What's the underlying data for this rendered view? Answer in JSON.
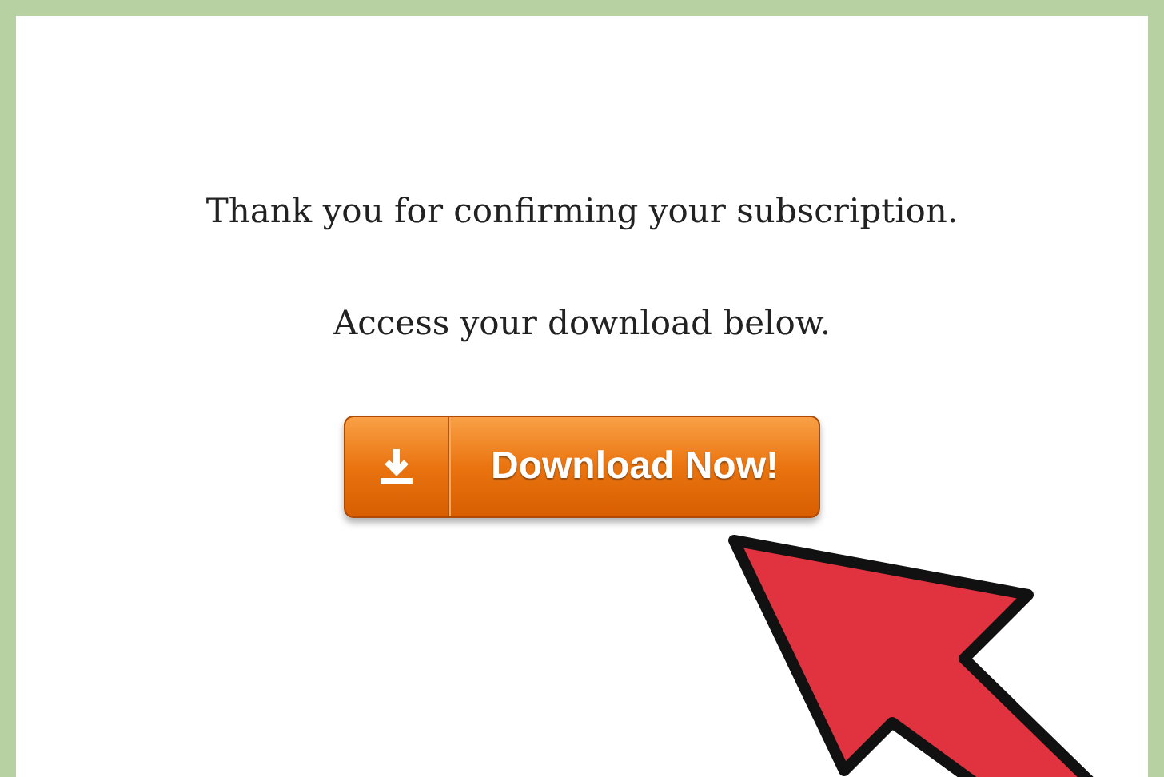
{
  "messages": [
    "Thank you for confirming your subscription.",
    "Access your download below."
  ],
  "button": {
    "label": "Download Now!"
  }
}
